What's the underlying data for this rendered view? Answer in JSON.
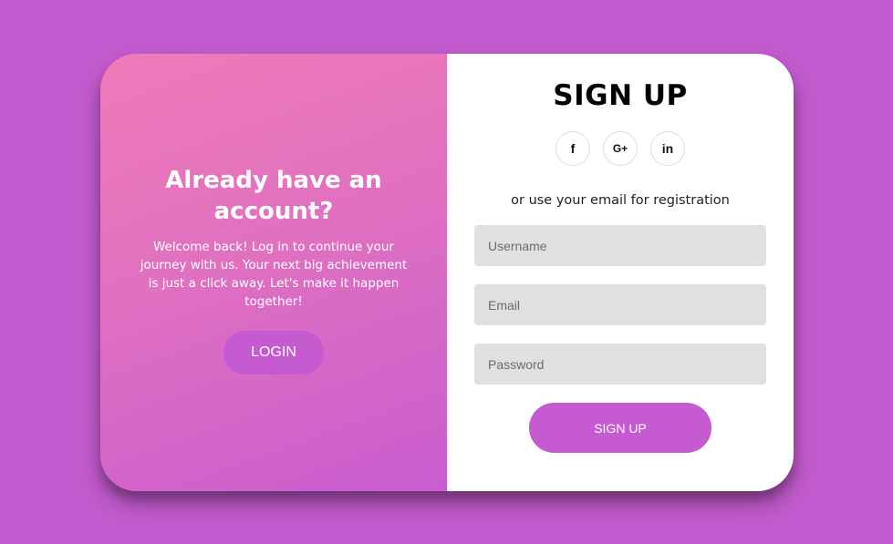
{
  "colors": {
    "page_background": "#c45bd0",
    "accent": "#c65ad1",
    "gradient_start": "#f07bb8",
    "gradient_end": "#c95cd0",
    "input_background": "#e0e0e0"
  },
  "left_panel": {
    "title": "Already have an account?",
    "text": "Welcome back! Log in to continue your journey with us. Your next big achievement is just a click away. Let's make it happen together!",
    "login_label": "LOGIN"
  },
  "right_panel": {
    "title": "SIGN UP",
    "social": [
      {
        "icon": "facebook-icon",
        "glyph": "f"
      },
      {
        "icon": "google-plus-icon",
        "glyph": "G+"
      },
      {
        "icon": "linkedin-icon",
        "glyph": "in"
      }
    ],
    "helper_text": "or use your email for registration",
    "username_placeholder": "Username",
    "email_placeholder": "Email",
    "password_placeholder": "Password",
    "signup_label": "SIGN UP"
  }
}
